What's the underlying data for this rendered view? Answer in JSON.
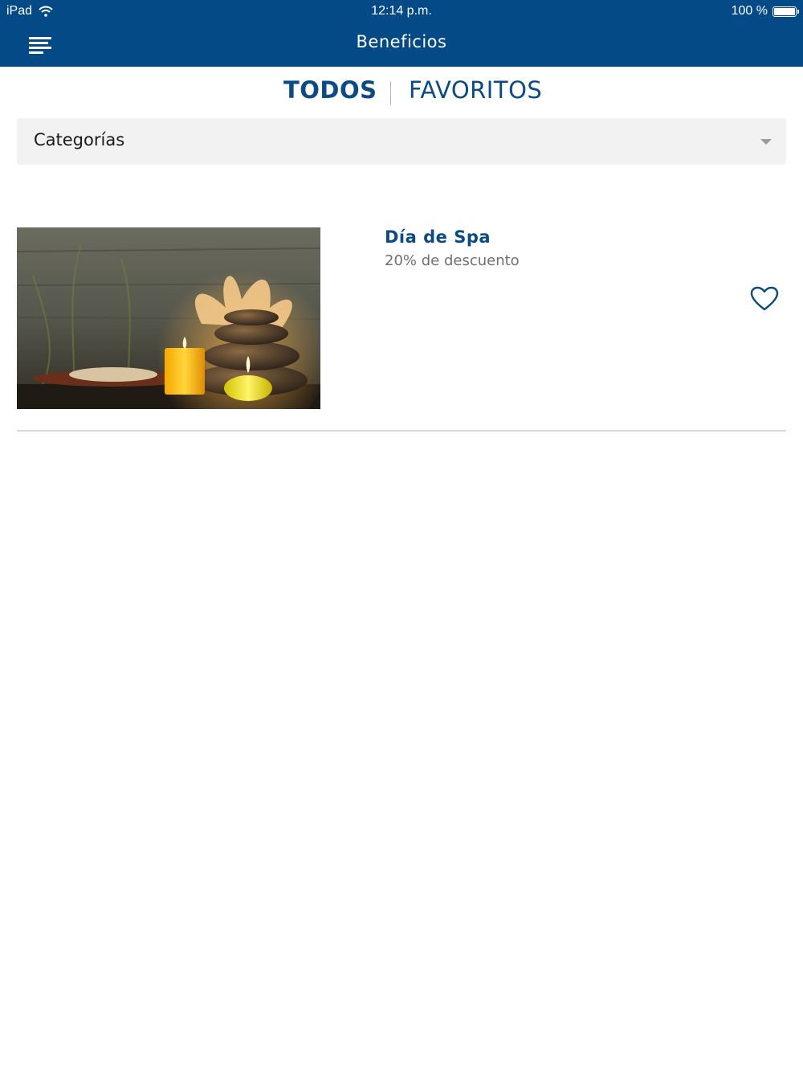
{
  "status_bar": {
    "device": "iPad",
    "time": "12:14 p.m.",
    "battery": "100 %",
    "battery_level": 1.0
  },
  "header": {
    "title": "Beneficios",
    "menu_icon": "menu-lines-icon"
  },
  "tabs": [
    {
      "label": "TODOS",
      "active": true
    },
    {
      "label": "FAVORITOS",
      "active": false
    }
  ],
  "filter": {
    "label": "Categorías",
    "icon": "chevron-down-icon"
  },
  "benefits": [
    {
      "title": "Día de Spa",
      "subtitle": "20% de descuento",
      "image": "spa candles and stones",
      "favorite_icon": "heart-outline-icon",
      "favorited": false
    }
  ],
  "colors": {
    "primary": "#044a87",
    "accent_text": "#0b4a82",
    "filter_bg": "#f2f2f2",
    "muted_text": "#707070"
  }
}
